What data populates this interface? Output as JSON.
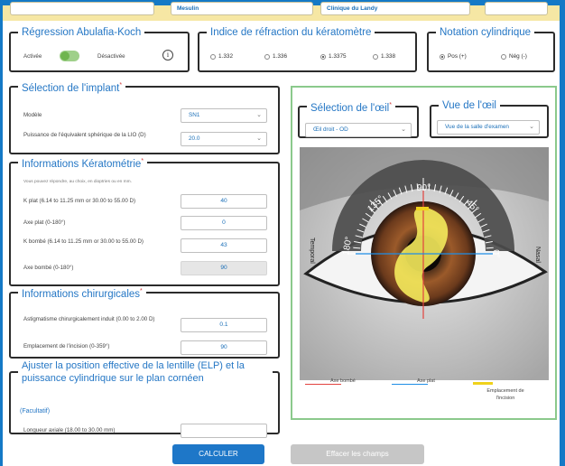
{
  "top_fields": [
    "Mesulin",
    "Clinique du Landy"
  ],
  "regression": {
    "title": "Régression Abulafia-Koch",
    "on_label": "Activée",
    "off_label": "Désactivée",
    "info_icon": "info-circle-icon"
  },
  "refraction": {
    "title": "Indice de réfraction du kératomètre",
    "options": [
      "1.332",
      "1.336",
      "1.3375",
      "1.338"
    ],
    "selected": "1.3375"
  },
  "cyl": {
    "title": "Notation cylindrique",
    "options": [
      "Pos (+)",
      "Nég (-)"
    ],
    "selected": "Pos (+)"
  },
  "implant": {
    "title": "Sélection de l'implant",
    "model_label": "Modèle",
    "model_value": "SN1",
    "power_label": "Puissance de l'équivalent sphérique de la LIO (D)",
    "power_value": "20.0"
  },
  "kerato": {
    "title": "Informations Kératométrie",
    "note": "Vous pouvez répondre, au choix, en dioptries ou en mm.",
    "fields": [
      {
        "label": "K plat (6.14 to 11.25 mm or 30.00 to 55.00 D)",
        "value": "40"
      },
      {
        "label": "Axe plat (0-180°)",
        "value": "0"
      },
      {
        "label": "K bombé (6.14 to 11.25 mm or 30.00 to 55.00 D)",
        "value": "43"
      },
      {
        "label": "Axe bombé (0-180°)",
        "value": "90"
      }
    ]
  },
  "surgical": {
    "title": "Informations chirurgicales",
    "fields": [
      {
        "label": "Astigmatisme chirurgicalement induit (0.00 to 2.00 D)",
        "value": "0.1"
      },
      {
        "label": "Emplacement de l'incision (0-359°)",
        "value": "90"
      }
    ]
  },
  "elp": {
    "title": "Ajuster la position effective de la lentille (ELP) et la puissance cylindrique sur le plan cornéen",
    "optional": "(Facultatif)",
    "field_label": "Longueur axiale (18.00 to 30.00 mm)",
    "field_value": ""
  },
  "eye_select": {
    "title": "Sélection de l'œil",
    "value": "Œil droit - OD"
  },
  "eye_view": {
    "title": "Vue de l'œil",
    "value": "Vue de la salle d'examen"
  },
  "eye_image": {
    "side_left": "Temporal",
    "side_right": "Nasal",
    "tick_labels": [
      "180°",
      "135°",
      "90°",
      "45°",
      "0°"
    ]
  },
  "legend": {
    "steep": "Axe bombé",
    "flat": "Axe plat",
    "incision": "Emplacement de l'incision"
  },
  "colors": {
    "steep": "#e2433f",
    "flat": "#1f8ee6",
    "incision": "#f0d21c",
    "accent": "#2577c5"
  },
  "buttons": {
    "calculate": "CALCULER",
    "clear": "Effacer les champs"
  }
}
